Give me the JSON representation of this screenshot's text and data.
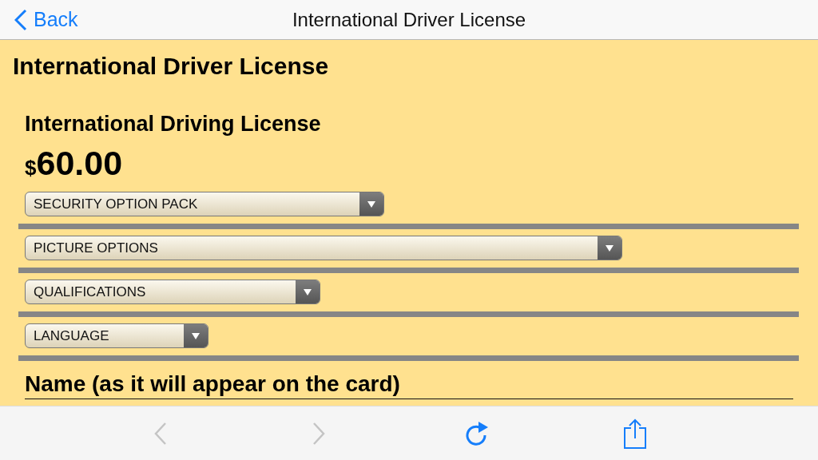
{
  "nav_bar": {
    "back": "Back",
    "title": "International Driver License"
  },
  "page": {
    "heading": "International Driver License",
    "product": "International Driving License",
    "price": {
      "currency": "$",
      "amount": "60.00"
    },
    "dropdowns": [
      {
        "label": "SECURITY OPTION PACK"
      },
      {
        "label": "PICTURE OPTIONS"
      },
      {
        "label": "QUALIFICATIONS"
      },
      {
        "label": "LANGUAGE"
      }
    ],
    "name_heading": "Name (as it will appear on the card)"
  },
  "toolbar": [
    {
      "kind": "back",
      "disabled": true
    },
    {
      "kind": "forward",
      "disabled": true
    },
    {
      "kind": "reload",
      "disabled": false
    },
    {
      "kind": "share",
      "disabled": false
    }
  ]
}
